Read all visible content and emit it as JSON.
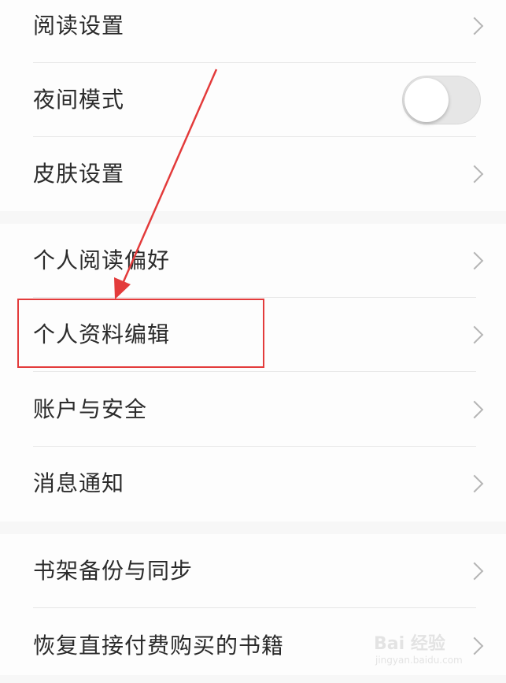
{
  "settings": {
    "group1": [
      {
        "label": "阅读设置",
        "control": "chevron"
      },
      {
        "label": "夜间模式",
        "control": "toggle",
        "toggle_on": false
      },
      {
        "label": "皮肤设置",
        "control": "chevron"
      }
    ],
    "group2": [
      {
        "label": "个人阅读偏好",
        "control": "chevron"
      },
      {
        "label": "个人资料编辑",
        "control": "chevron",
        "highlighted": true
      },
      {
        "label": "账户与安全",
        "control": "chevron"
      },
      {
        "label": "消息通知",
        "control": "chevron"
      }
    ],
    "group3": [
      {
        "label": "书架备份与同步",
        "control": "chevron"
      },
      {
        "label": "恢复直接付费购买的书籍",
        "control": "chevron"
      }
    ]
  },
  "annotation": {
    "color": "#e33b3b"
  },
  "watermark": {
    "brand": "Bai 经验",
    "url": "jingyan.baidu.com"
  }
}
